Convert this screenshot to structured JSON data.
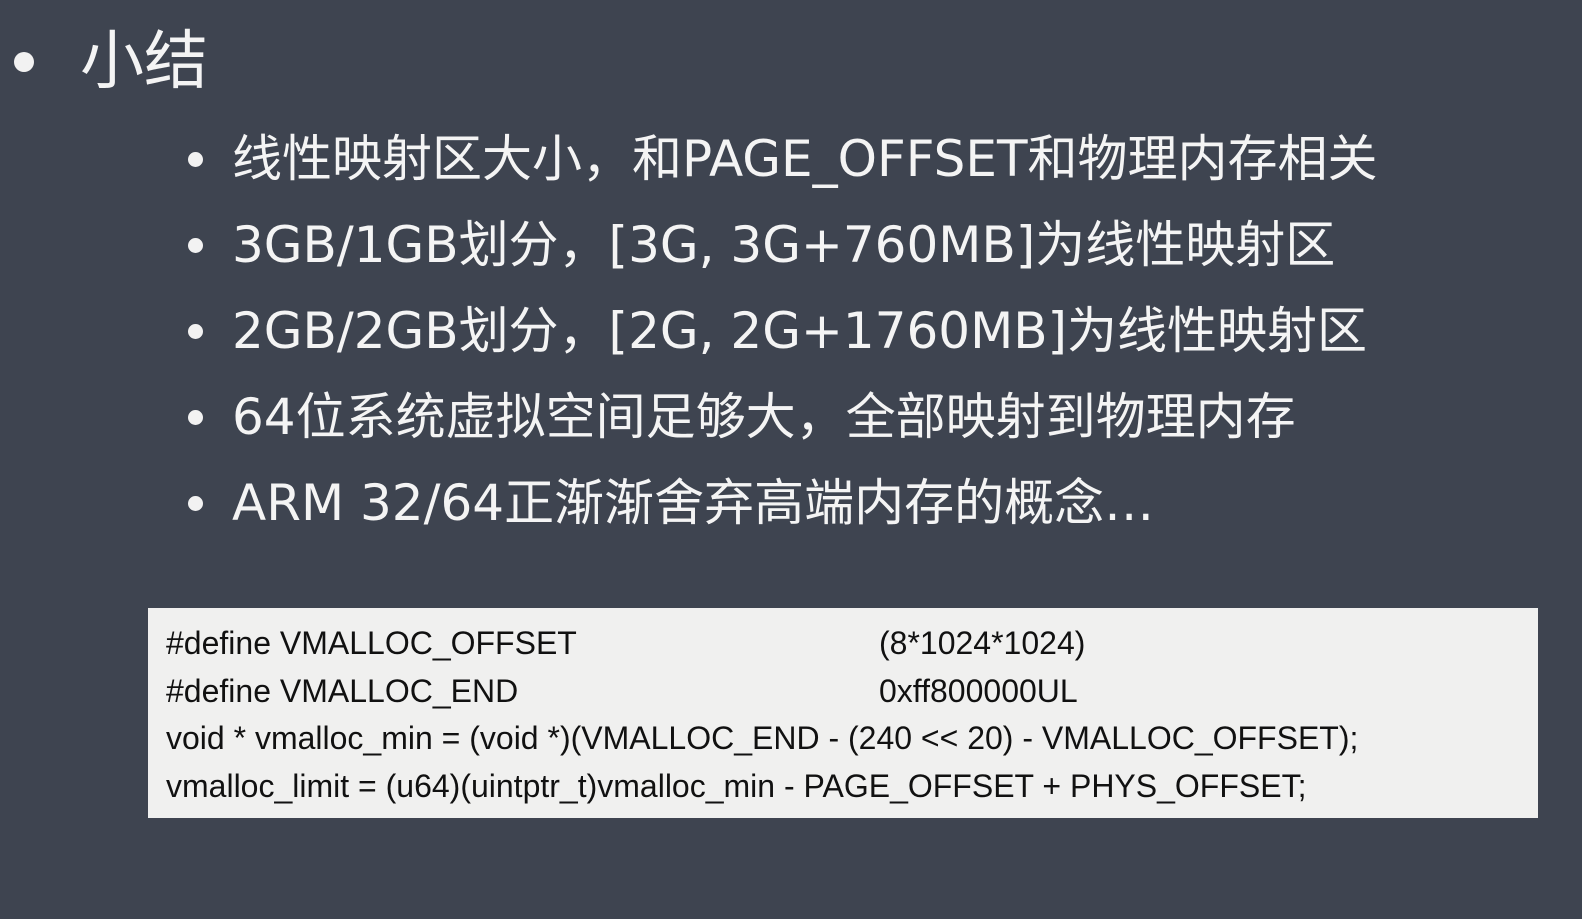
{
  "slide": {
    "title": "小结",
    "bullets": [
      "线性映射区大小，和PAGE_OFFSET和物理内存相关",
      "3GB/1GB划分，[3G, 3G+760MB]为线性映射区",
      "2GB/2GB划分，[2G, 2G+1760MB]为线性映射区",
      "64位系统虚拟空间足够大，全部映射到物理内存",
      "ARM 32/64正渐渐舍弃高端内存的概念…"
    ],
    "code": {
      "line1_name": "#define VMALLOC_OFFSET",
      "line1_value": "(8*1024*1024)",
      "line2_name": "#define VMALLOC_END",
      "line2_value": "0xff800000UL",
      "line3": "void *  vmalloc_min = (void *)(VMALLOC_END - (240 << 20) - VMALLOC_OFFSET);",
      "line4": "vmalloc_limit = (u64)(uintptr_t)vmalloc_min - PAGE_OFFSET + PHYS_OFFSET;"
    }
  },
  "colors": {
    "background": "#3e4450",
    "text": "#f4f4f4",
    "code_background": "#f0f0ef",
    "code_text": "#111111"
  }
}
